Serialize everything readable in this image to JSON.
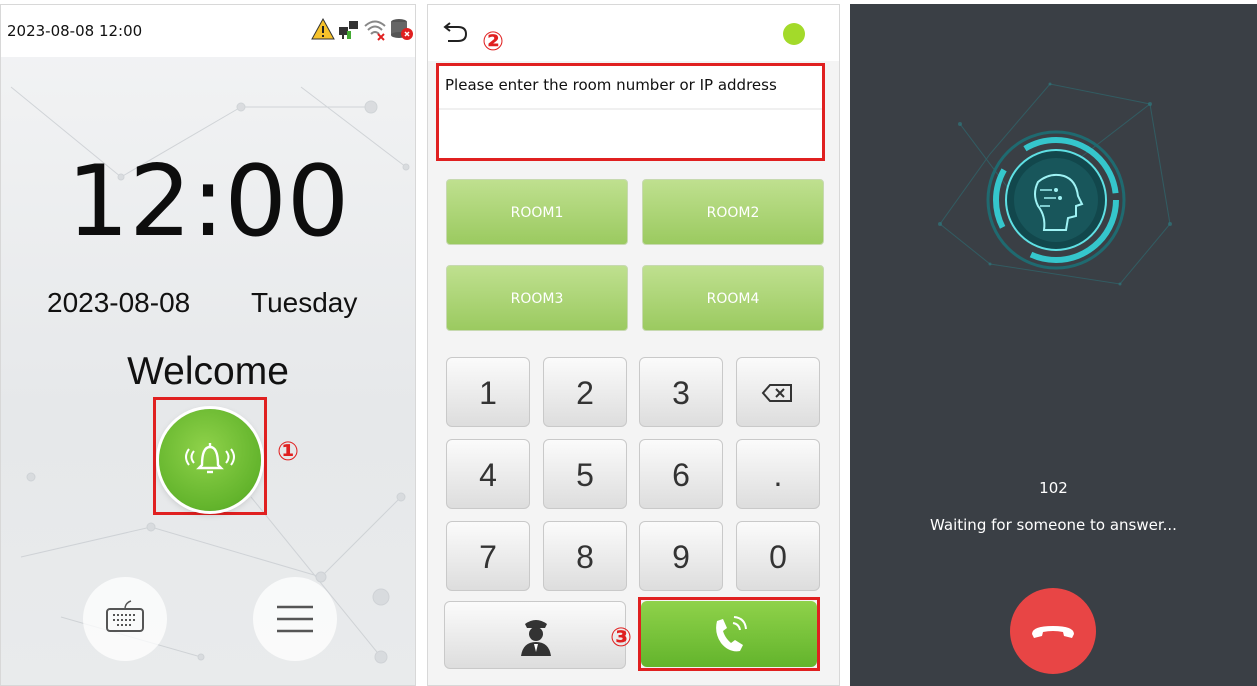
{
  "standby": {
    "status_datetime": "2023-08-08 12:00",
    "clock": "12:00",
    "date": "2023-08-08",
    "weekday": "Tuesday",
    "welcome": "Welcome",
    "marker": "①",
    "icons": [
      "warning-icon",
      "network-icon",
      "wifi-disconnected-icon",
      "database-icon",
      "doorbell-icon",
      "keyboard-icon",
      "menu-icon"
    ]
  },
  "dial": {
    "placeholder": "Please enter the room number or IP address",
    "input_value": "",
    "marker_top": "②",
    "marker_bottom": "③",
    "rooms": [
      "ROOM1",
      "ROOM2",
      "ROOM3",
      "ROOM4"
    ],
    "keys": [
      "1",
      "2",
      "3",
      "4",
      "5",
      "6",
      "7",
      "8",
      "9",
      "0",
      "."
    ],
    "accent": "#a3da2a"
  },
  "calling": {
    "number": "102",
    "status": "Waiting for someone to answer...",
    "hangup_color": "#e84545"
  }
}
